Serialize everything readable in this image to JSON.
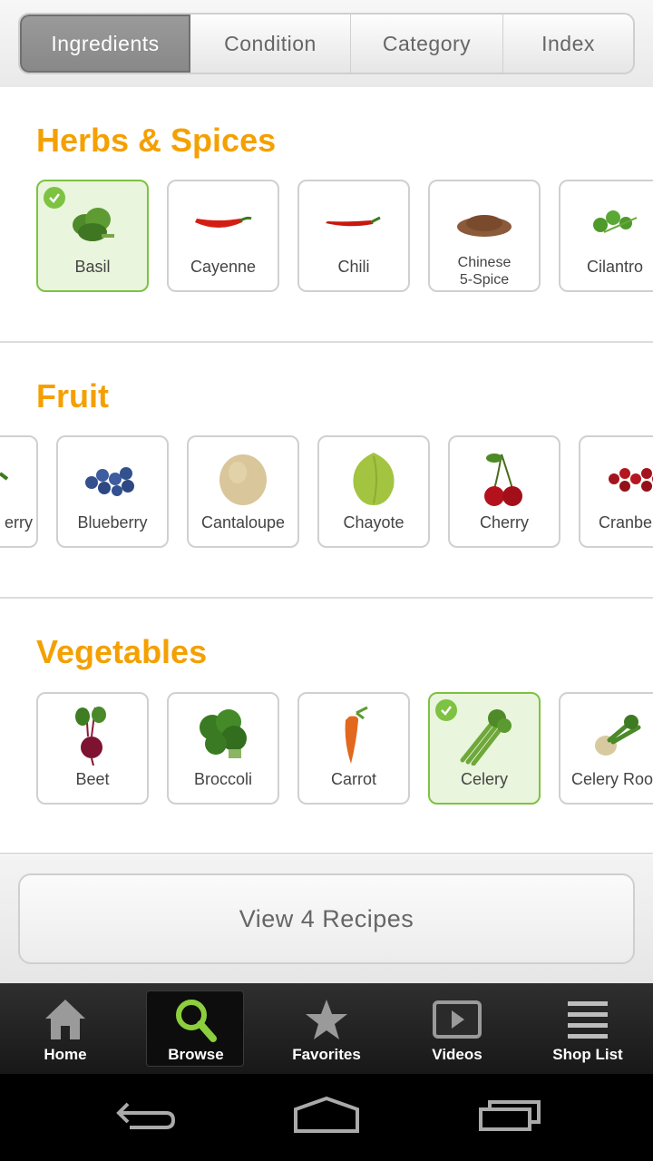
{
  "tabs": [
    {
      "label": "Ingredients",
      "active": true
    },
    {
      "label": "Condition",
      "active": false
    },
    {
      "label": "Category",
      "active": false
    },
    {
      "label": "Index",
      "active": false
    }
  ],
  "sections": [
    {
      "title": "Herbs & Spices",
      "items": [
        {
          "label": "Basil",
          "selected": true,
          "icon": "basil-icon"
        },
        {
          "label": "Cayenne",
          "selected": false,
          "icon": "cayenne-pepper-icon"
        },
        {
          "label": "Chili",
          "selected": false,
          "icon": "chili-pepper-icon"
        },
        {
          "label": "Chinese\n5-Spice",
          "selected": false,
          "icon": "spice-powder-icon"
        },
        {
          "label": "Cilantro",
          "selected": false,
          "icon": "cilantro-icon"
        }
      ]
    },
    {
      "title": "Fruit",
      "items": [
        {
          "label": "erry",
          "selected": false,
          "icon": "berry-icon"
        },
        {
          "label": "Blueberry",
          "selected": false,
          "icon": "blueberry-icon"
        },
        {
          "label": "Cantaloupe",
          "selected": false,
          "icon": "cantaloupe-icon"
        },
        {
          "label": "Chayote",
          "selected": false,
          "icon": "chayote-icon"
        },
        {
          "label": "Cherry",
          "selected": false,
          "icon": "cherry-icon"
        },
        {
          "label": "Cranbe",
          "selected": false,
          "icon": "cranberry-icon"
        }
      ]
    },
    {
      "title": "Vegetables",
      "items": [
        {
          "label": "Beet",
          "selected": false,
          "icon": "beet-icon"
        },
        {
          "label": "Broccoli",
          "selected": false,
          "icon": "broccoli-icon"
        },
        {
          "label": "Carrot",
          "selected": false,
          "icon": "carrot-icon"
        },
        {
          "label": "Celery",
          "selected": true,
          "icon": "celery-icon"
        },
        {
          "label": "Celery Roo",
          "selected": false,
          "icon": "celery-root-icon"
        }
      ]
    }
  ],
  "view_button": "View 4 Recipes",
  "nav": [
    {
      "label": "Home",
      "icon": "home-icon",
      "active": false
    },
    {
      "label": "Browse",
      "icon": "search-icon",
      "active": true
    },
    {
      "label": "Favorites",
      "icon": "star-icon",
      "active": false
    },
    {
      "label": "Videos",
      "icon": "video-icon",
      "active": false
    },
    {
      "label": "Shop List",
      "icon": "list-icon",
      "active": false
    }
  ],
  "colors": {
    "accent": "#f4a000",
    "selected": "#7ec242"
  }
}
